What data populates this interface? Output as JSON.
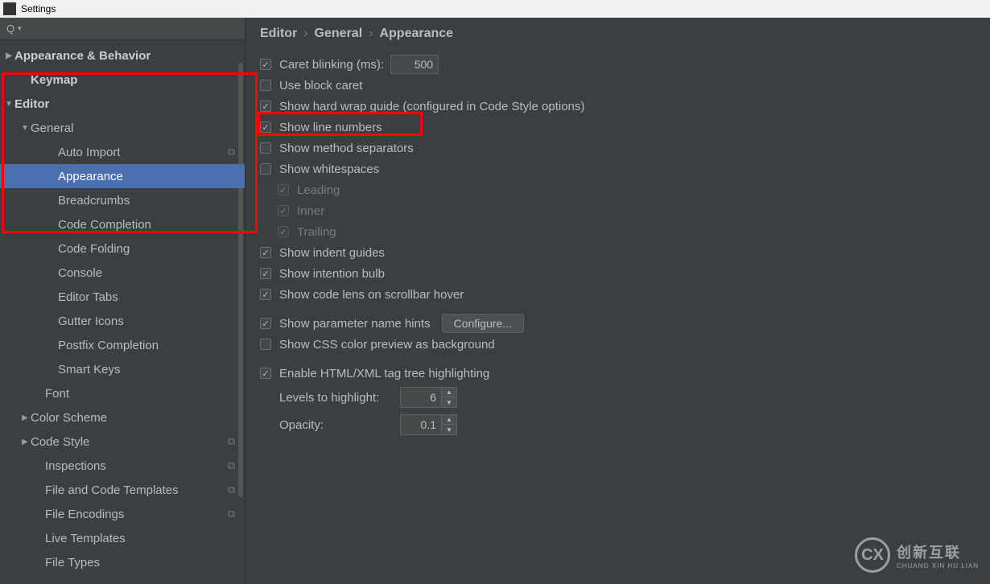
{
  "window": {
    "title": "Settings"
  },
  "breadcrumb": {
    "a": "Editor",
    "b": "General",
    "c": "Appearance"
  },
  "sidebar": {
    "items": [
      {
        "label": "Appearance & Behavior",
        "indent": 20,
        "bold": true,
        "toggle": "▶"
      },
      {
        "label": "Keymap",
        "indent": 38,
        "bold": true
      },
      {
        "label": "Editor",
        "indent": 20,
        "bold": true,
        "toggle": "▼"
      },
      {
        "label": "General",
        "indent": 40,
        "toggle": "▼"
      },
      {
        "label": "Auto Import",
        "indent": 72,
        "badge": "⧉"
      },
      {
        "label": "Appearance",
        "indent": 72,
        "selected": true
      },
      {
        "label": "Breadcrumbs",
        "indent": 72
      },
      {
        "label": "Code Completion",
        "indent": 72
      },
      {
        "label": "Code Folding",
        "indent": 72
      },
      {
        "label": "Console",
        "indent": 72
      },
      {
        "label": "Editor Tabs",
        "indent": 72
      },
      {
        "label": "Gutter Icons",
        "indent": 72
      },
      {
        "label": "Postfix Completion",
        "indent": 72
      },
      {
        "label": "Smart Keys",
        "indent": 72
      },
      {
        "label": "Font",
        "indent": 56
      },
      {
        "label": "Color Scheme",
        "indent": 40,
        "toggle": "▶"
      },
      {
        "label": "Code Style",
        "indent": 40,
        "toggle": "▶",
        "badge": "⧉"
      },
      {
        "label": "Inspections",
        "indent": 56,
        "badge": "⧉"
      },
      {
        "label": "File and Code Templates",
        "indent": 56,
        "badge": "⧉"
      },
      {
        "label": "File Encodings",
        "indent": 56,
        "badge": "⧉"
      },
      {
        "label": "Live Templates",
        "indent": 56
      },
      {
        "label": "File Types",
        "indent": 56
      }
    ]
  },
  "options": {
    "caret_blinking": "Caret blinking (ms):",
    "caret_blinking_value": "500",
    "use_block_caret": "Use block caret",
    "hard_wrap": "Show hard wrap guide (configured in Code Style options)",
    "line_numbers": "Show line numbers",
    "method_separators": "Show method separators",
    "whitespaces": "Show whitespaces",
    "leading": "Leading",
    "inner": "Inner",
    "trailing": "Trailing",
    "indent_guides": "Show indent guides",
    "intention_bulb": "Show intention bulb",
    "code_lens": "Show code lens on scrollbar hover",
    "param_hints": "Show parameter name hints",
    "configure_btn": "Configure...",
    "css_preview": "Show CSS color preview as background",
    "html_xml": "Enable HTML/XML tag tree highlighting",
    "levels_label": "Levels to highlight:",
    "levels_value": "6",
    "opacity_label": "Opacity:",
    "opacity_value": "0.1"
  },
  "watermark": {
    "logo": "CX",
    "big": "创新互联",
    "small": "CHUANG XIN HU LIAN"
  }
}
